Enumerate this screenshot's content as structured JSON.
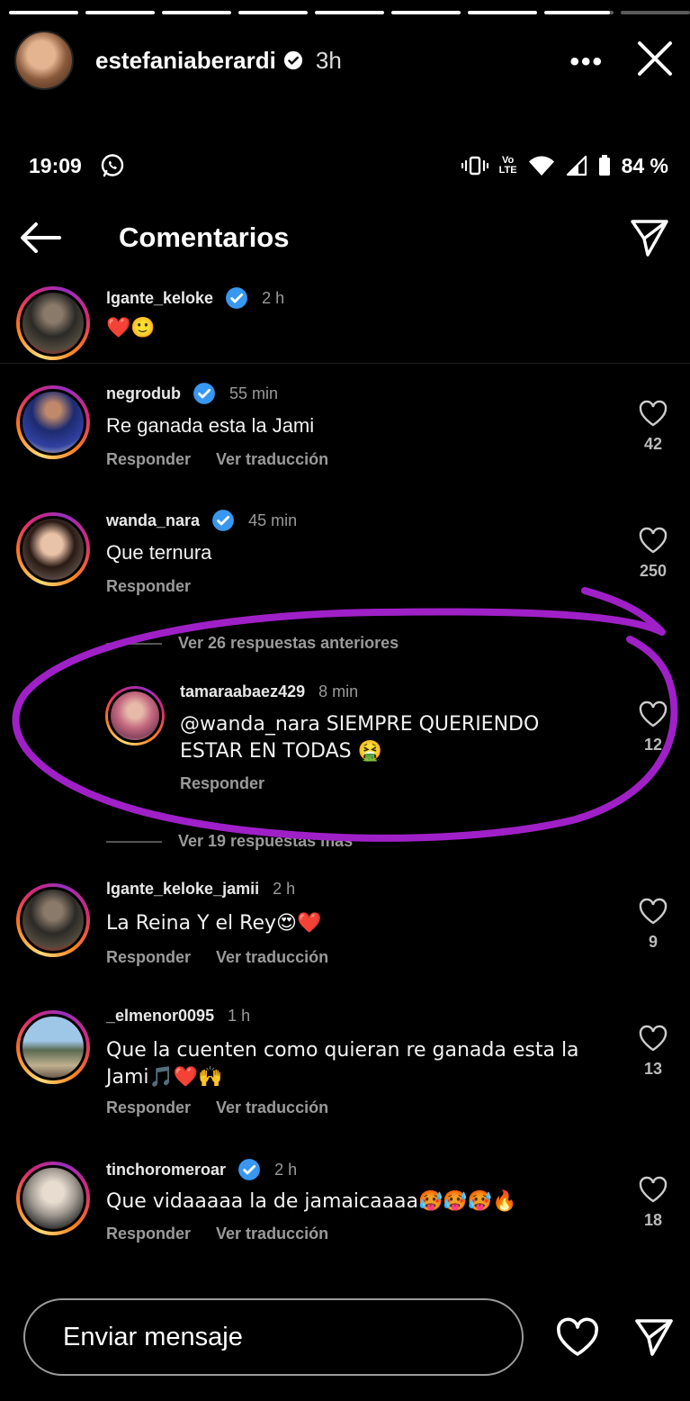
{
  "story": {
    "username": "estefaniaberardi",
    "time": "3h",
    "more_label": "•••",
    "progress": [
      1,
      1,
      1,
      1,
      1,
      1,
      1,
      0.95,
      0
    ]
  },
  "status_bar": {
    "time": "19:09",
    "network_top": "Vo",
    "network_bottom": "LTE",
    "battery": "84 %"
  },
  "comments_header": {
    "title": "Comentarios"
  },
  "comments": [
    {
      "username": "lgante_keloke",
      "time": "2 h",
      "text": "❤️🙂",
      "verified": true
    },
    {
      "username": "negrodub",
      "time": "55 min",
      "text": "Re ganada esta la Jami",
      "reply": "Responder",
      "translate": "Ver traducción",
      "likes": "42",
      "verified": true
    },
    {
      "username": "wanda_nara",
      "time": "45 min",
      "text": "Que ternura",
      "reply": "Responder",
      "likes": "250",
      "verified": true
    },
    {
      "username": "tamaraabaez429",
      "time": "8 min",
      "text": "@wanda_nara SIEMPRE QUERIENDO ESTAR EN TODAS 🤮",
      "reply": "Responder",
      "likes": "12"
    },
    {
      "username": "lgante_keloke_jamii",
      "time": "2 h",
      "text": "La Reina Y el Rey😍❤️",
      "reply": "Responder",
      "translate": "Ver traducción",
      "likes": "9"
    },
    {
      "username": "_elmenor0095",
      "time": "1 h",
      "text": "Que la cuenten como quieran re ganada esta la Jami🎵❤️🙌",
      "reply": "Responder",
      "translate": "Ver traducción",
      "likes": "13"
    },
    {
      "username": "tinchoromeroar",
      "time": "2 h",
      "text": "Que vidaaaaa la de jamaicaaaa🥵🥵🥵🔥",
      "reply": "Responder",
      "translate": "Ver traducción",
      "likes": "18",
      "verified": true
    }
  ],
  "replies_links": {
    "previous": "Ver 26 respuestas anteriores",
    "more": "Ver 19 respuestas más"
  },
  "bottom_bar": {
    "placeholder": "Enviar mensaje"
  },
  "colors": {
    "background": "#000000",
    "verified": "#3897f0",
    "annotation": "#a020c8"
  }
}
